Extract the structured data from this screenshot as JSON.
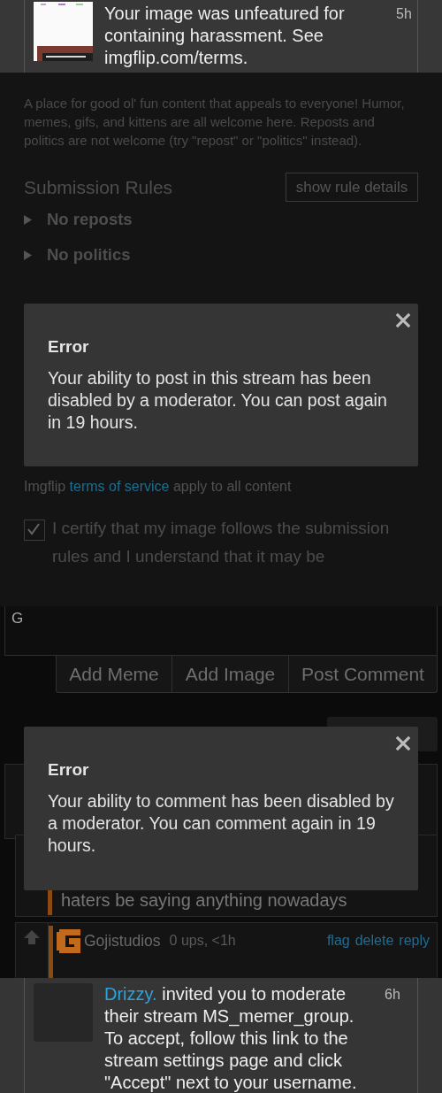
{
  "notification_top": {
    "text": "Your image was unfeatured for containing harassment. See imgflip.com/terms.",
    "time": "5h"
  },
  "stream_page": {
    "description": "A place for good ol' fun content that appeals to everyone! Humor, memes, gifs, and kittens are all welcome here. Reposts and politics are not welcome (try \"repost\" or \"politics\" instead).",
    "rules_heading": "Submission Rules",
    "rules_button": "show rule details",
    "rules": [
      {
        "label": "No reposts",
        "expanded": false
      },
      {
        "label": "No politics",
        "expanded": false
      }
    ],
    "terms": {
      "prefix": "Imgflip",
      "link": "terms of service",
      "suffix": "apply to all content"
    },
    "certify": {
      "checked": true,
      "text": "I certify that my image follows the submission rules and I understand that it may be"
    },
    "error_dialog": {
      "title": "Error",
      "message": "Your ability to post in this stream has been disabled by a moderator. You can post again in 19 hours."
    }
  },
  "comment_page": {
    "comment_field": {
      "value": "G"
    },
    "buttons": [
      "Add Meme",
      "Add Image",
      "Post Comment"
    ],
    "error_dialog": {
      "title": "Error",
      "message": "Your ability to comment has been disabled by a moderator. You can comment again in 19 hours."
    },
    "reply": {
      "text": "haters be saying anything nowadays"
    },
    "comment": {
      "author": "Gojistudios",
      "meta": "0 ups, <1h",
      "actions": [
        "flag",
        "delete",
        "reply"
      ]
    }
  },
  "notification_bottom": {
    "user": "Drizzy.",
    "text": "invited you to moderate their stream MS_memer_group. To accept, follow this link to the stream settings page and click \"Accept\" next to your username.",
    "time": "6h"
  }
}
